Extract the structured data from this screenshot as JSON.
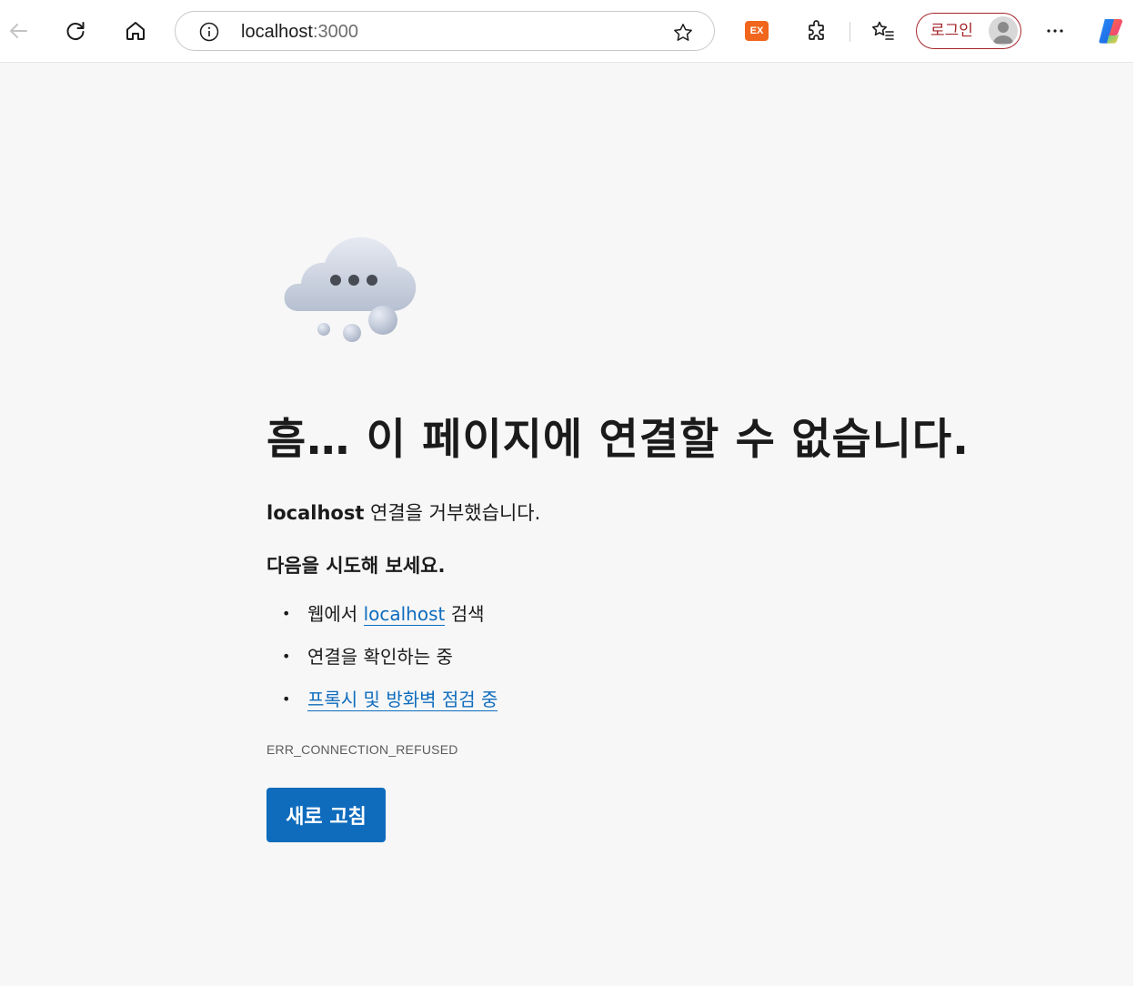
{
  "browser": {
    "address_bar": {
      "host": "localhost",
      "port": ":3000"
    },
    "extension_badge": "EX",
    "profile_button_label": "로그인",
    "icons": {
      "back": "back-arrow-icon",
      "refresh": "refresh-icon",
      "home": "home-icon",
      "site_info": "info-icon",
      "favorite": "star-icon",
      "extensions": "puzzle-icon",
      "favorites_list": "favorites-icon",
      "more": "more-icon",
      "copilot": "copilot-icon"
    }
  },
  "error_page": {
    "heading": "흠… 이 페이지에 연결할 수 없습니다.",
    "sub_host": "localhost",
    "sub_message": " 연결을 거부했습니다.",
    "try_heading": "다음을 시도해 보세요.",
    "suggestions": {
      "search_prefix": "웹에서 ",
      "search_link": "localhost",
      "search_suffix": " 검색",
      "check_connection": "연결을 확인하는 중",
      "check_proxy": "프록시 및 방화벽 점검 중"
    },
    "error_code": "ERR_CONNECTION_REFUSED",
    "refresh_button": "새로 고침"
  },
  "colors": {
    "accent": "#0f6cbd",
    "profile": "#a4262c",
    "extension": "#f1661d",
    "background": "#f7f7f7"
  }
}
